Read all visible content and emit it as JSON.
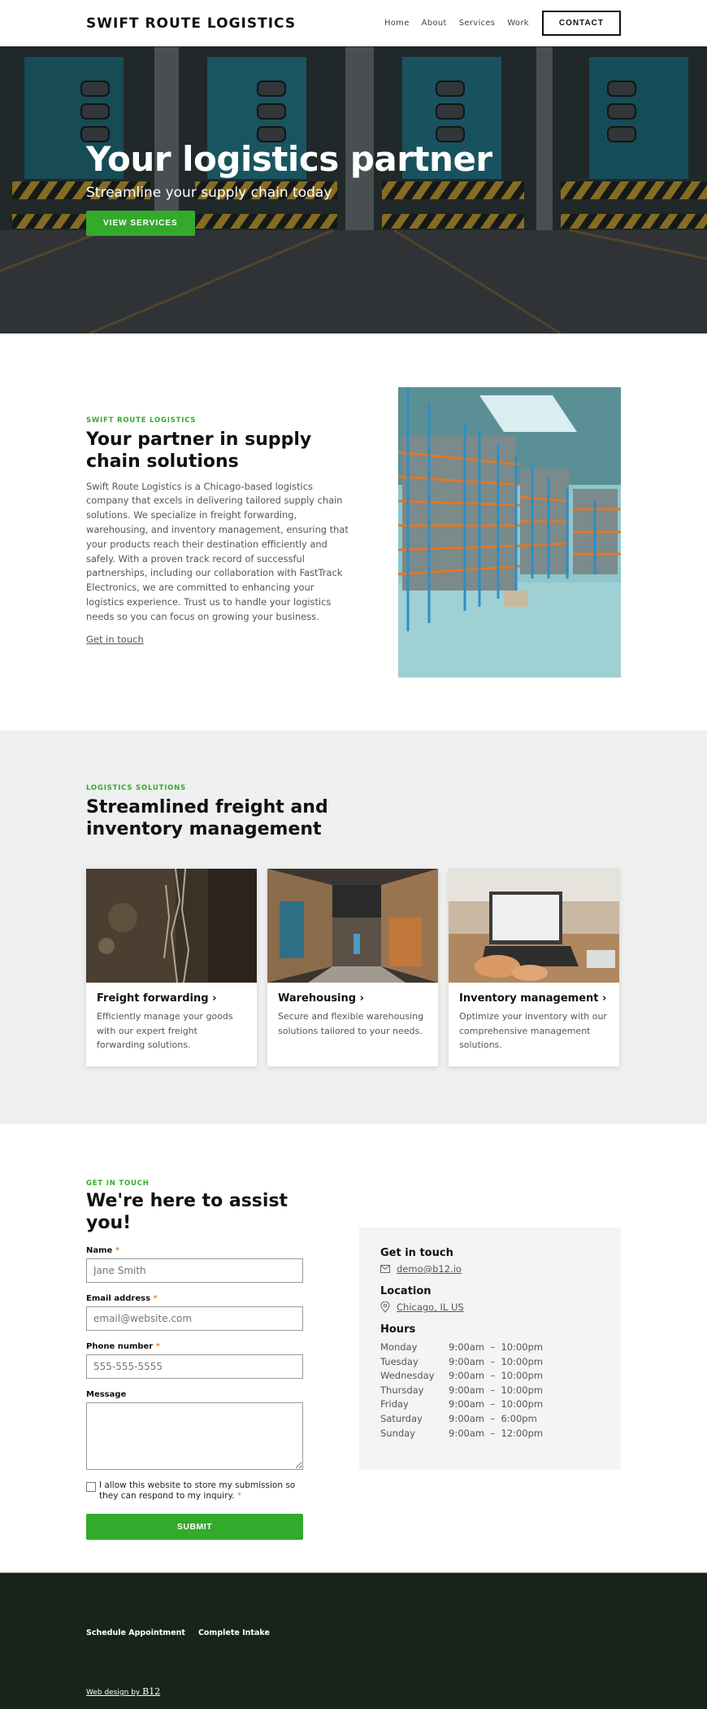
{
  "header": {
    "logo": "SWIFT ROUTE LOGISTICS",
    "nav": [
      {
        "label": "Home"
      },
      {
        "label": "About"
      },
      {
        "label": "Services"
      },
      {
        "label": "Work"
      }
    ],
    "cta_label": "CONTACT"
  },
  "hero": {
    "title": "Your logistics partner",
    "subtitle": "Streamline your supply chain today",
    "button_label": "VIEW SERVICES"
  },
  "about": {
    "eyebrow": "SWIFT ROUTE LOGISTICS",
    "heading": "Your partner in supply chain solutions",
    "body": "Swift Route Logistics is a Chicago-based logistics company that excels in delivering tailored supply chain solutions. We specialize in freight forwarding, warehousing, and inventory management, ensuring that your products reach their destination efficiently and safely. With a proven track record of successful partnerships, including our collaboration with FastTrack Electronics, we are committed to enhancing your logistics experience. Trust us to handle your logistics needs so you can focus on growing your business.",
    "link_label": "Get in touch",
    "image_alt": "Warehouse with blue and orange pallet racks"
  },
  "services": {
    "eyebrow": "LOGISTICS SOLUTIONS",
    "heading": "Streamlined freight and inventory management",
    "cards": [
      {
        "title": "Freight forwarding",
        "description": "Efficiently manage your goods with our expert freight forwarding solutions."
      },
      {
        "title": "Warehousing",
        "description": "Secure and flexible warehousing solutions tailored to your needs."
      },
      {
        "title": "Inventory management",
        "description": "Optimize your inventory with our comprehensive management solutions."
      }
    ]
  },
  "contact": {
    "eyebrow": "GET IN TOUCH",
    "heading": "We're here to assist you!",
    "fields": {
      "name": {
        "label": "Name",
        "placeholder": "Jane Smith",
        "required": "*"
      },
      "email": {
        "label": "Email address",
        "placeholder": "email@website.com",
        "required": "*"
      },
      "phone": {
        "label": "Phone number",
        "placeholder": "555-555-5555",
        "required": "*"
      },
      "message": {
        "label": "Message"
      }
    },
    "consent_text": "I allow this website to store my submission so they can respond to my inquiry.",
    "consent_required": "*",
    "submit_label": "SUBMIT",
    "info": {
      "touch_title": "Get in touch",
      "email": "demo@b12.io",
      "location_title": "Location",
      "location": "Chicago, IL US",
      "hours_title": "Hours",
      "hours": [
        {
          "day": "Monday",
          "time": "9:00am  –  10:00pm"
        },
        {
          "day": "Tuesday",
          "time": "9:00am  –  10:00pm"
        },
        {
          "day": "Wednesday",
          "time": "9:00am  –  10:00pm"
        },
        {
          "day": "Thursday",
          "time": "9:00am  –  10:00pm"
        },
        {
          "day": "Friday",
          "time": "9:00am  –  10:00pm"
        },
        {
          "day": "Saturday",
          "time": "9:00am  –  6:00pm"
        },
        {
          "day": "Sunday",
          "time": "9:00am  –  12:00pm"
        }
      ]
    }
  },
  "footer": {
    "links": [
      {
        "label": "Schedule Appointment"
      },
      {
        "label": "Complete Intake"
      }
    ],
    "credit_prefix": "Web design by ",
    "credit_brand": "B12"
  },
  "colors": {
    "accent": "#33aa2c",
    "section_bg": "#eef0ef",
    "info_bg": "#f3f4f3",
    "footer_bg": "#18241a",
    "required": "#e08a3c"
  }
}
